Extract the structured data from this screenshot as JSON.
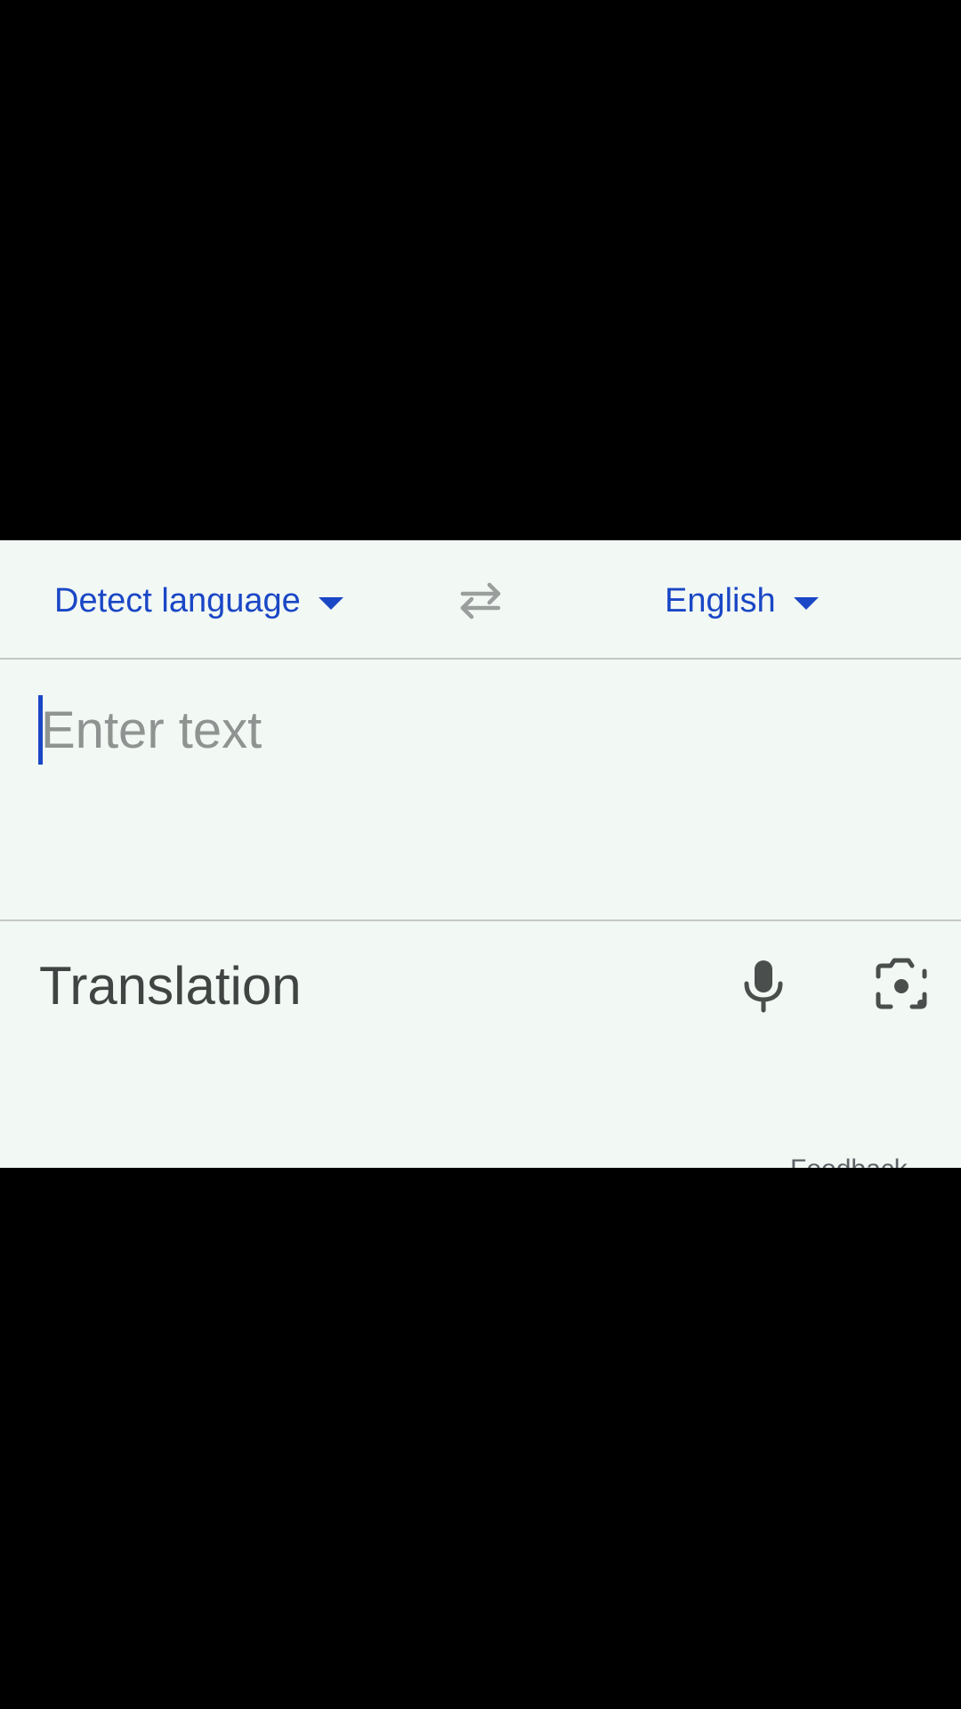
{
  "language_bar": {
    "source_language": "Detect language",
    "target_language": "English",
    "swap_icon": "swap-horiz-icon"
  },
  "input": {
    "placeholder": "Enter text",
    "value": "",
    "mic_icon": "mic-icon",
    "camera_icon": "camera-lens-icon"
  },
  "output": {
    "placeholder": "Translation",
    "feedback_label": "Feedback"
  },
  "colors": {
    "accent": "#1a47c6",
    "panel_bg": "#f2f8f4",
    "divider": "#c4c8c6",
    "icon_gray": "#4a4e4c"
  }
}
